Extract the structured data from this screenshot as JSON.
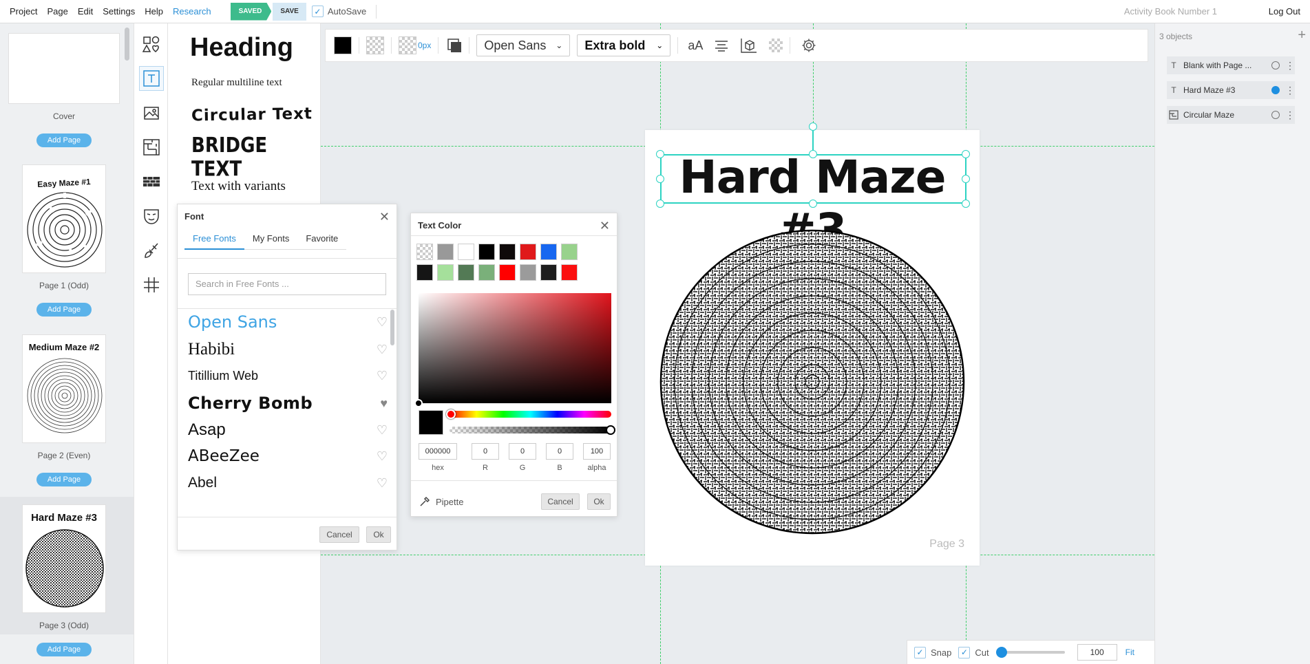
{
  "menu": [
    "Project",
    "Page",
    "Edit",
    "Settings",
    "Help"
  ],
  "menu_research": "Research",
  "status": {
    "saved": "SAVED",
    "save": "SAVE",
    "autosave": "AutoSave"
  },
  "document_title": "Activity Book Number 1",
  "logout": "Log Out",
  "pages": [
    {
      "label": "Cover",
      "title": ""
    },
    {
      "label": "Page 1 (Odd)",
      "title": "Easy Maze #1"
    },
    {
      "label": "Page 2 (Even)",
      "title": "Medium Maze #2"
    },
    {
      "label": "Page 3 (Odd)",
      "title": "Hard Maze #3"
    }
  ],
  "add_page": "Add Page",
  "text_styles": {
    "heading": "Heading",
    "regular": "Regular multiline text",
    "circular": "Circular Text",
    "bridge": "BRIDGE TEXT",
    "variants": "Text with variants"
  },
  "toolbar": {
    "stroke_width": "0px",
    "font_family": "Open Sans",
    "font_weight": "Extra bold",
    "case": "aA"
  },
  "font_dialog": {
    "title": "Font",
    "tabs": [
      "Free Fonts",
      "My Fonts",
      "Favorite"
    ],
    "search_placeholder": "Search in Free Fonts ...",
    "fonts": [
      "Open Sans",
      "Habibi",
      "Titillium Web",
      "Cherry Bomb",
      "Asap",
      "ABeeZee",
      "Abel"
    ],
    "cancel": "Cancel",
    "ok": "Ok"
  },
  "color_dialog": {
    "title": "Text Color",
    "swatches_row1": [
      "transparent",
      "#999999",
      "#ffffff",
      "#000000",
      "#0f0a0a",
      "#e0191b",
      "#1767f0",
      "#98d28c"
    ],
    "swatches_row2": [
      "#151515",
      "#a5e09b",
      "#537a55",
      "#7ab07a",
      "#ff0000",
      "#9b9b9b",
      "#1d1d1d",
      "#fb0f0f"
    ],
    "hex": "000000",
    "r": "0",
    "g": "0",
    "b": "0",
    "alpha": "100",
    "labels": {
      "hex": "hex",
      "r": "R",
      "g": "G",
      "b": "B",
      "alpha": "alpha"
    },
    "pipette": "Pipette",
    "cancel": "Cancel",
    "ok": "Ok"
  },
  "canvas": {
    "title": "Hard Maze #3",
    "page_number": "Page 3"
  },
  "objects": {
    "count": "3 objects",
    "items": [
      {
        "name": "Blank with Page ...",
        "icon": "text-icon",
        "selected": false
      },
      {
        "name": "Hard Maze #3",
        "icon": "text-icon",
        "selected": true
      },
      {
        "name": "Circular Maze",
        "icon": "maze-icon",
        "selected": false
      }
    ]
  },
  "bottom": {
    "snap": "Snap",
    "cut": "Cut",
    "zoom": "100",
    "fit": "Fit"
  }
}
